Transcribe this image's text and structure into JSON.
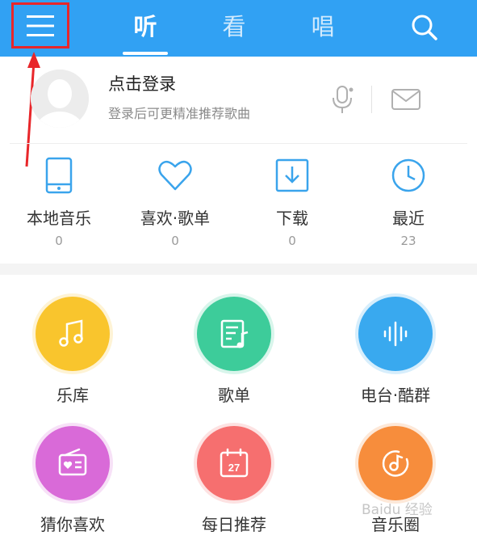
{
  "header": {
    "tabs": [
      {
        "label": "听",
        "active": true
      },
      {
        "label": "看",
        "active": false
      },
      {
        "label": "唱",
        "active": false
      }
    ],
    "background_color": "#31a1f3",
    "highlight_color": "#e8262a"
  },
  "account": {
    "title": "点击登录",
    "subtitle": "登录后可更精准推荐歌曲"
  },
  "quick_links": [
    {
      "label": "本地音乐",
      "count": "0",
      "icon": "tablet-icon"
    },
    {
      "label": "喜欢·歌单",
      "count": "0",
      "icon": "heart-icon"
    },
    {
      "label": "下载",
      "count": "0",
      "icon": "download-icon"
    },
    {
      "label": "最近",
      "count": "23",
      "icon": "clock-icon"
    }
  ],
  "grid": [
    {
      "label": "乐库",
      "color": "#f9c52d",
      "icon": "music-note-icon"
    },
    {
      "label": "歌单",
      "color": "#3dcc9a",
      "icon": "playlist-icon"
    },
    {
      "label": "电台·酷群",
      "color": "#39a9ef",
      "icon": "soundwave-icon"
    },
    {
      "label": "猜你喜欢",
      "color": "#d96ad8",
      "icon": "radio-heart-icon"
    },
    {
      "label": "每日推荐",
      "color": "#f66f6f",
      "icon": "calendar-icon",
      "badge": "27"
    },
    {
      "label": "音乐圈",
      "color": "#f78d3c",
      "icon": "disc-note-icon"
    }
  ],
  "quick_icon_color": "#3aa4ec",
  "watermark": "Baidu 经验"
}
